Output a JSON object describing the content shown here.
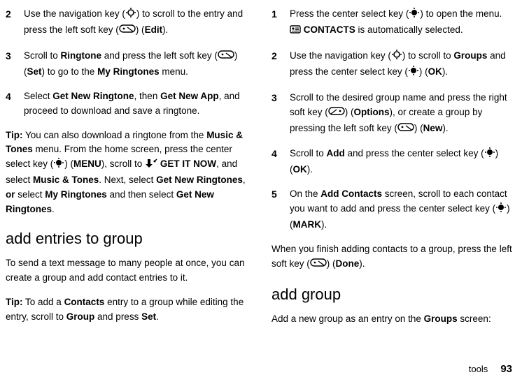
{
  "left": {
    "step2": {
      "num": "2",
      "t1": "Use the navigation key (",
      "t2": ") to scroll to the entry and press the left soft key (",
      "t3": ") (",
      "edit": "Edit",
      "t4": ")."
    },
    "step3": {
      "num": "3",
      "t1": "Scroll to ",
      "ringtone": "Ringtone",
      "t2": " and press the left soft key (",
      "t3": ") (",
      "set": "Set",
      "t4": ") to go to the ",
      "myrt": "My Ringtones",
      "t5": " menu."
    },
    "step4": {
      "num": "4",
      "t1": "Select ",
      "gnr": "Get New Ringtone",
      "t2": ", then ",
      "gna": "Get New App",
      "t3": ", and proceed to download and save a ringtone."
    },
    "tip1": {
      "tip": "Tip:",
      "t1": " You can also download a ringtone from the ",
      "mt": "Music & Tones",
      "t2": " menu. From the home screen, press the center select key (",
      "t3": ") (",
      "menu": "MENU",
      "t4": "), scroll to ",
      "get": "GET IT NOW",
      "t5": ", and select ",
      "mt2": "Music & Tones",
      "t6": ". Next, select ",
      "gnr": "Get New Ringtones",
      "t7": ", ",
      "or": "or",
      "t8": " select ",
      "myrt": "My Ringtones",
      "t9": " and then select ",
      "gnr2": "Get New Ringtones",
      "t10": "."
    },
    "h_add_entries": "add entries to group",
    "para1": "To send a text message to many people at once, you can create a group and add contact entries to it.",
    "tip2": {
      "tip": "Tip:",
      "t1": " To add a ",
      "contacts": "Contacts",
      "t2": " entry to a group while editing the entry, scroll to ",
      "group": "Group",
      "t3": " and press ",
      "set": "Set",
      "t4": "."
    }
  },
  "right": {
    "step1": {
      "num": "1",
      "t1": "Press the center select key (",
      "t2": ") to open the menu. ",
      "contacts": "CONTACTS",
      "t3": " is automatically selected."
    },
    "step2": {
      "num": "2",
      "t1": "Use the navigation key (",
      "t2": ") to scroll to ",
      "groups": "Groups",
      "t3": " and press the center select key (",
      "t4": ") (",
      "ok": "OK",
      "t5": ")."
    },
    "step3": {
      "num": "3",
      "t1": "Scroll to the desired group name and press the right soft key (",
      "t2": ") (",
      "options": "Options",
      "t3": "), or create a group by pressing the left soft key (",
      "t4": ") (",
      "new": "New",
      "t5": ")."
    },
    "step4": {
      "num": "4",
      "t1": "Scroll to ",
      "add": "Add",
      "t2": " and press the center select key (",
      "t3": ") (",
      "ok": "OK",
      "t4": ")."
    },
    "step5": {
      "num": "5",
      "t1": "On the ",
      "ac": "Add Contacts",
      "t2": " screen, scroll to each contact you want to add and press the center select key (",
      "t3": ") (",
      "mark": "MARK",
      "t4": ")."
    },
    "para_done": {
      "t1": "When you finish adding contacts to a group, press the left soft key (",
      "t2": ") (",
      "done": "Done",
      "t3": ")."
    },
    "h_add_group": "add group",
    "para_addgroup": {
      "t1": "Add a new group as an entry on the ",
      "groups": "Groups",
      "t2": " screen:"
    }
  },
  "footer": {
    "section": "tools",
    "page": "93"
  }
}
